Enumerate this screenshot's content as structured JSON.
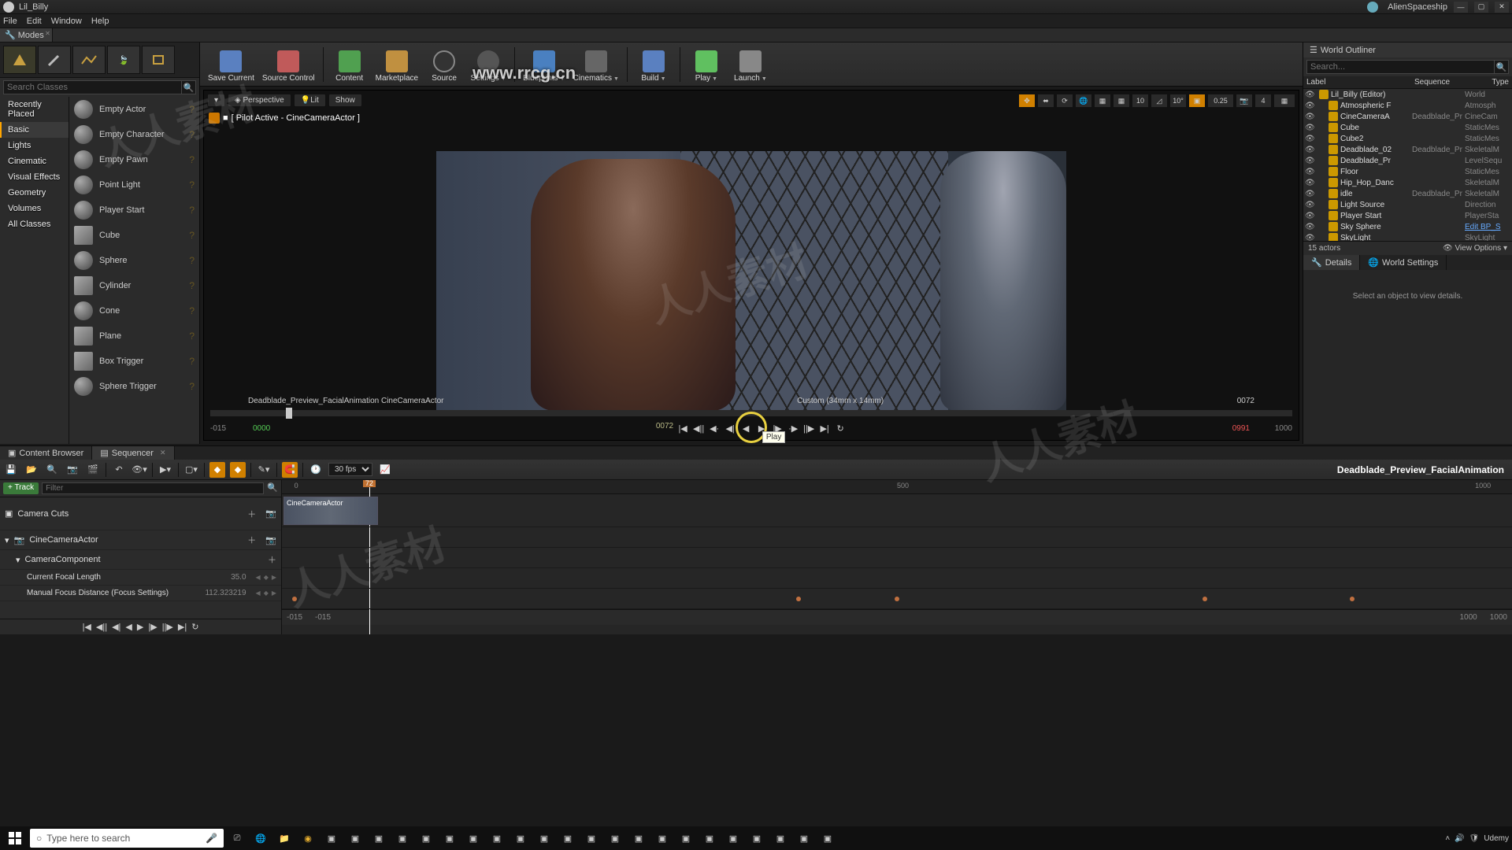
{
  "titlebar": {
    "level_name": "Lil_Billy",
    "project_name": "AlienSpaceship"
  },
  "menu": {
    "file": "File",
    "edit": "Edit",
    "window": "Window",
    "help": "Help"
  },
  "modes_tab": "Modes",
  "toolbar": {
    "save": "Save Current",
    "source_control": "Source Control",
    "content": "Content",
    "marketplace": "Marketplace",
    "source": "Source",
    "settings": "Settings",
    "blueprints": "Blueprints",
    "cinematics": "Cinematics",
    "build": "Build",
    "play": "Play",
    "launch": "Launch"
  },
  "place_panel": {
    "search_placeholder": "Search Classes",
    "categories": [
      "Recently Placed",
      "Basic",
      "Lights",
      "Cinematic",
      "Visual Effects",
      "Geometry",
      "Volumes",
      "All Classes"
    ],
    "selected_category": "Basic",
    "actors": [
      "Empty Actor",
      "Empty Character",
      "Empty Pawn",
      "Point Light",
      "Player Start",
      "Cube",
      "Sphere",
      "Cylinder",
      "Cone",
      "Plane",
      "Box Trigger",
      "Sphere Trigger"
    ]
  },
  "viewport": {
    "perspective": "Perspective",
    "lit": "Lit",
    "show": "Show",
    "pilot": "[ Pilot Active - CineCameraActor ]",
    "snap_angle": "10",
    "snap_angle2": "10°",
    "scale": "0.25",
    "cam_speed": "4",
    "info_left": "Deadblade_Preview_FacialAnimation  CineCameraActor",
    "info_center": "Custom (34mm x 14mm)",
    "info_right": "0072",
    "frame_start_disp": "-015",
    "frame_start": "0000",
    "frame_cur": "0072",
    "frame_end": "0991",
    "frame_end_disp": "1000",
    "tooltip": "Play"
  },
  "outliner": {
    "tab": "World Outliner",
    "search_placeholder": "Search...",
    "col_label": "Label",
    "col_sequence": "Sequence",
    "col_type": "Type",
    "rows": [
      {
        "label": "Lil_Billy (Editor)",
        "type": "World",
        "indent": 0
      },
      {
        "label": "Atmospheric F",
        "type": "Atmosph",
        "indent": 1
      },
      {
        "label": "CineCameraA",
        "seq": "Deadblade_Preview_Fac",
        "type": "CineCam",
        "indent": 1
      },
      {
        "label": "Cube",
        "type": "StaticMes",
        "indent": 1
      },
      {
        "label": "Cube2",
        "type": "StaticMes",
        "indent": 1
      },
      {
        "label": "Deadblade_02",
        "seq": "Deadblade_Preview_Fac",
        "type": "SkeletalM",
        "indent": 1
      },
      {
        "label": "Deadblade_Pr",
        "type": "LevelSequ",
        "indent": 1
      },
      {
        "label": "Floor",
        "type": "StaticMes",
        "indent": 1
      },
      {
        "label": "Hip_Hop_Danc",
        "type": "SkeletalM",
        "indent": 1
      },
      {
        "label": "idle",
        "seq": "Deadblade_Preview_Fac",
        "type": "SkeletalM",
        "indent": 1
      },
      {
        "label": "Light Source",
        "type": "Direction",
        "indent": 1
      },
      {
        "label": "Player Start",
        "type": "PlayerSta",
        "indent": 1
      },
      {
        "label": "Sky Sphere",
        "type": "Edit BP_S",
        "indent": 1,
        "link": true
      },
      {
        "label": "SkyLight",
        "type": "SkyLight",
        "indent": 1
      }
    ],
    "footer_count": "15 actors",
    "footer_view": "View Options"
  },
  "details": {
    "tab_details": "Details",
    "tab_world": "World Settings",
    "empty": "Select an object to view details."
  },
  "bottom_tabs": {
    "content": "Content Browser",
    "sequencer": "Sequencer"
  },
  "sequencer": {
    "fps": "30 fps",
    "name": "Deadblade_Preview_FacialAnimation",
    "add_track": "+ Track",
    "filter_placeholder": "Filter",
    "playhead": "72",
    "ruler": [
      "0",
      "500",
      "1000"
    ],
    "tracks": {
      "camera_cuts": "Camera Cuts",
      "cine_camera": "CineCameraActor",
      "camera_component": "CameraComponent",
      "focal_length": "Current Focal Length",
      "focal_length_val": "35.0",
      "focus_dist": "Manual Focus Distance (Focus Settings)",
      "focus_dist_val": "112.323219",
      "clip_label": "CineCameraActor"
    },
    "footer": {
      "l1": "-015",
      "l2": "-015",
      "r1": "1000",
      "r2": "1000"
    }
  },
  "taskbar": {
    "search_placeholder": "Type here to search",
    "tray_text": "Udemy"
  },
  "watermark_url": "www.rrcg.cn"
}
